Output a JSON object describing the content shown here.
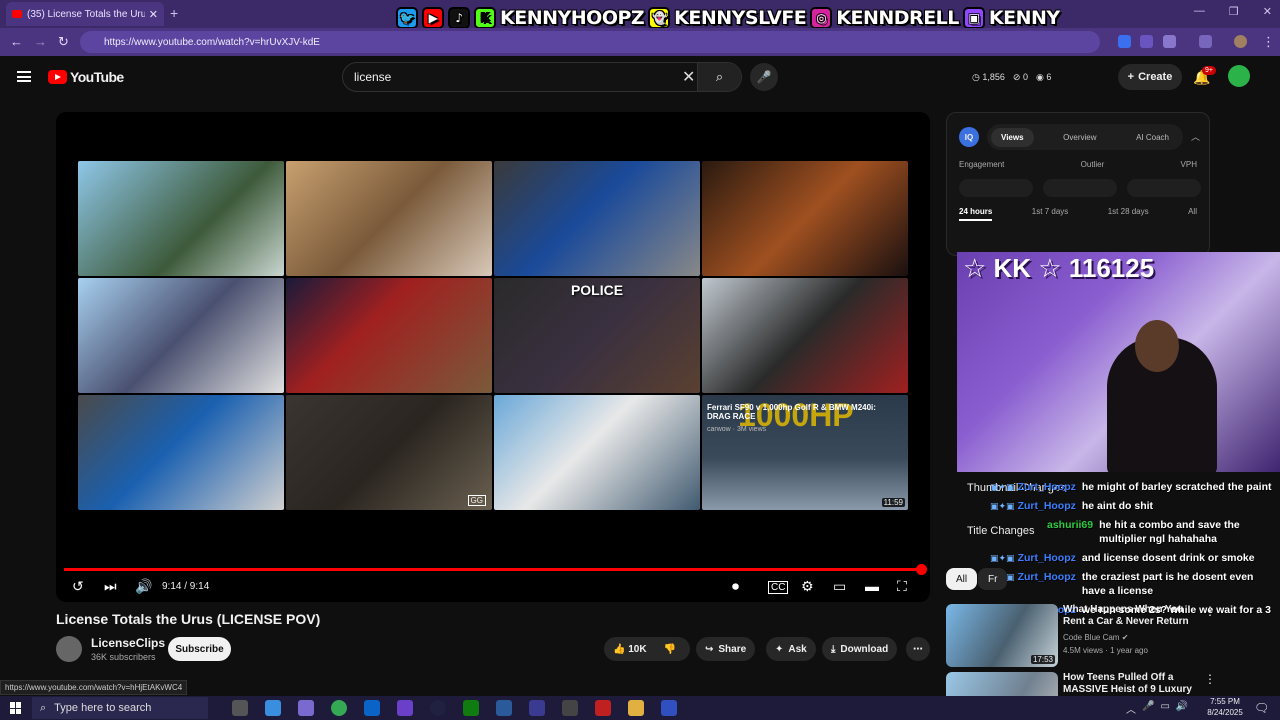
{
  "browser": {
    "tab_title": "(35) License Totals the Urus (LIC",
    "url": "https://www.youtube.com/watch?v=hrUvXJV-kdE",
    "status_url": "https://www.youtube.com/watch?v=hHjEtAKvWC4"
  },
  "banner": {
    "handle_1": "KENNYHOOPZ",
    "handle_2": "KENNYSLVFE",
    "handle_3": "KENNDRELL",
    "handle_4": "KENNY"
  },
  "youtube": {
    "logo_text": "YouTube",
    "search_value": "license",
    "stats": {
      "views": "1,856",
      "comments": "0",
      "likes": "6"
    },
    "create_label": "Create",
    "notif_badge": "9+"
  },
  "player": {
    "thumb_police_label": "POLICE",
    "thumb_12_caption": "Ferrari SF90 v 1,000hp Golf R & BMW M240i: DRAG RACE",
    "thumb_12_meta": "carwow · 3M views",
    "thumb_12_big": "1000HP",
    "thumb_12_duration": "11:59",
    "thumb_11_watermark": "GG",
    "time": "9:14 / 9:14",
    "progress_fraction": 1.0
  },
  "video": {
    "title": "License Totals the Urus (LICENSE POV)",
    "channel": "LicenseClips",
    "subs": "36K subscribers",
    "subscribe": "Subscribe",
    "likes": "10K",
    "share": "Share",
    "ask": "Ask",
    "download": "Download"
  },
  "vidiq": {
    "logo": "IQ",
    "tabs": [
      "Views",
      "Overview",
      "AI Coach"
    ],
    "metrics": [
      "Engagement",
      "Outlier",
      "VPH"
    ],
    "ranges": [
      "24 hours",
      "1st 7 days",
      "1st 28 days",
      "All"
    ]
  },
  "overlay": {
    "cam_label": "☆ KK ☆ 116125",
    "card_1": "Thumbnail Changes",
    "card_2": "Title Changes",
    "chat": [
      {
        "user": "Zurt_Hoopz",
        "msg": "he might of barley scratched the paint"
      },
      {
        "user": "Zurt_Hoopz",
        "msg": "he aint do shit"
      },
      {
        "user": "ashurii69",
        "msg": "he hit a combo and save the multiplier ngl hahahaha"
      },
      {
        "user": "Zurt_Hoopz",
        "msg": "and license dosent drink or smoke"
      },
      {
        "user": "Zurt_Hoopz",
        "msg": "the craziest part is he dosent even have a license"
      },
      {
        "user": "Zurt_Hoopz",
        "msg": "we run some 2s? while we wait for a 3"
      }
    ]
  },
  "chips": {
    "all": "All",
    "second": "Fr"
  },
  "recs": [
    {
      "title": "What Happens When You Rent a Car & Never Return",
      "channel": "Code Blue Cam",
      "meta": "4.5M views · 1 year ago",
      "duration": "17:53"
    },
    {
      "title": "How Teens Pulled Off a MASSIVE Heist of 9 Luxury Cars",
      "channel": "",
      "meta": "",
      "duration": ""
    }
  ],
  "taskbar": {
    "search_placeholder": "Type here to search",
    "time": "7:55 PM",
    "date": "8/24/2025"
  }
}
